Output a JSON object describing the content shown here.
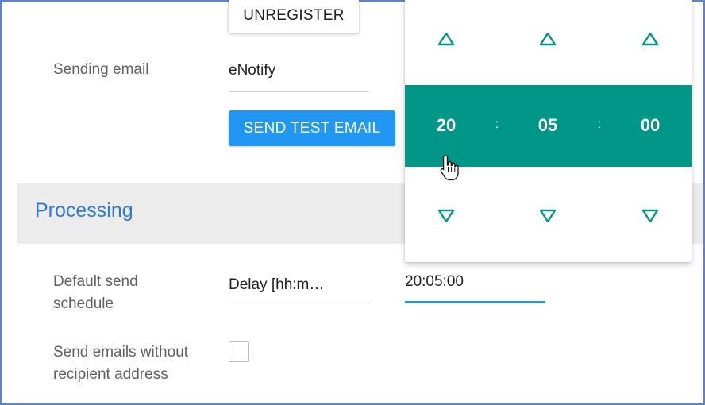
{
  "email": {
    "unregister_label": "UNREGISTER",
    "sending_email_label": "Sending email",
    "sending_email_value": "eNotify",
    "send_test_label": "SEND TEST EMAIL"
  },
  "processing": {
    "title": "Processing",
    "default_schedule_label_line1": "Default send",
    "default_schedule_label_line2": "schedule",
    "schedule_type_value": "Delay [hh:m…",
    "schedule_time_value": "20:05:00",
    "send_without_recipient_line1": "Send emails without",
    "send_without_recipient_line2": "recipient address",
    "send_without_recipient_checked": false
  },
  "time_picker": {
    "hours": "20",
    "minutes": "05",
    "seconds": "00",
    "separator": ":",
    "accent_color": "#009688",
    "up_icon": "triangle-up-icon",
    "down_icon": "triangle-down-icon"
  },
  "colors": {
    "primary": "#2196f3",
    "section_title": "#2e7bd6",
    "picker_accent": "#009688"
  }
}
